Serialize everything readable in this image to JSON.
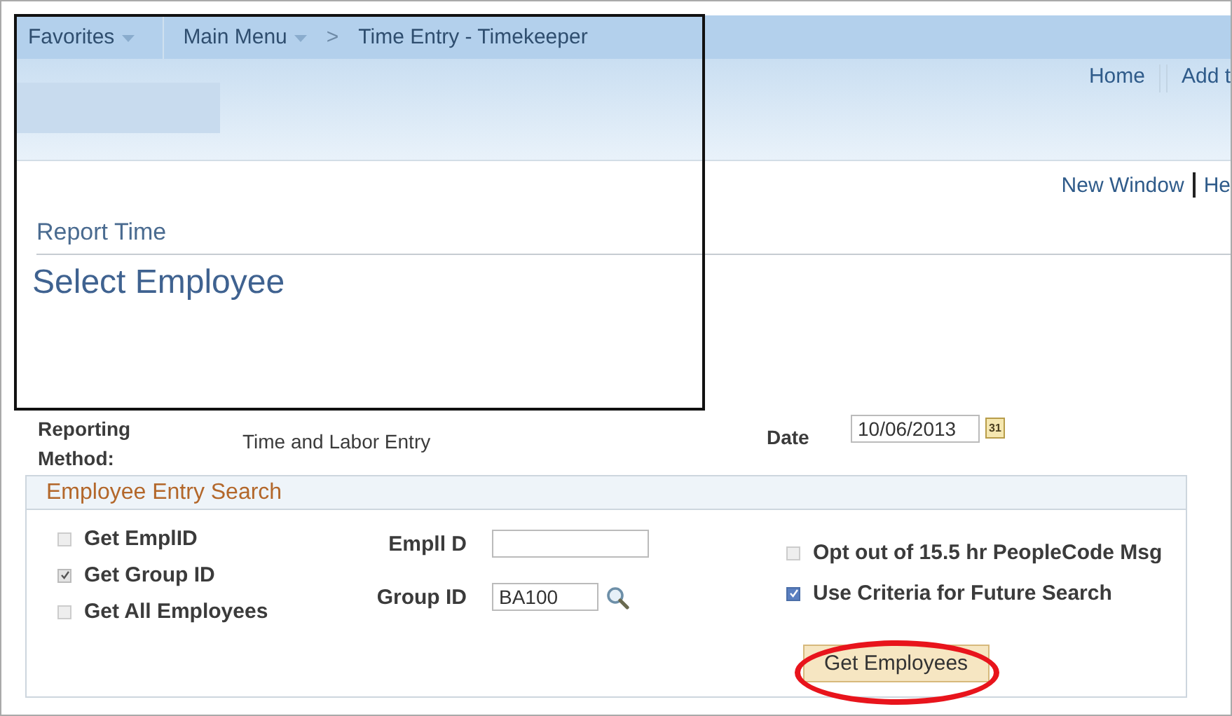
{
  "breadcrumb": [
    {
      "label": "Favorites",
      "dropdown": true
    },
    {
      "label": "Main Menu",
      "dropdown": true
    },
    {
      "label": "Time Entry - Timekeeper",
      "dropdown": false,
      "separator": ">"
    }
  ],
  "header_links": [
    "Home",
    "Add t"
  ],
  "page_links": [
    "New Window",
    "He"
  ],
  "page_title": "Report Time",
  "subtitle": "Select Employee",
  "reporting_method": {
    "label": "Reporting Method:",
    "value": "Time and Labor Entry"
  },
  "date": {
    "label": "Date",
    "value": "10/06/2013",
    "calendar_icon_text": "31"
  },
  "section": {
    "title": "Employee Entry Search",
    "left_options": [
      {
        "label": "Get EmplID",
        "checked": false
      },
      {
        "label": "Get Group ID",
        "checked": true
      },
      {
        "label": "Get All Employees",
        "checked": false
      }
    ],
    "fields": [
      {
        "label": "Empll D",
        "lookup": false
      },
      {
        "label": "Group ID",
        "value": "BA100",
        "lookup": true
      }
    ],
    "right_options": [
      {
        "label": "Opt out of 15.5 hr PeopleCode Msg",
        "checked": false
      },
      {
        "label": "Use Criteria for Future Search",
        "checked": true
      }
    ],
    "button": "Get Employees"
  }
}
